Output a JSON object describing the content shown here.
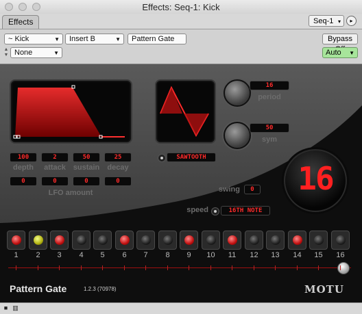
{
  "window": {
    "title": "Effects: Seq-1: Kick"
  },
  "tabs": {
    "effects": "Effects",
    "sequence": "Seq-1",
    "sequence_arrow": "▾",
    "play": "▸"
  },
  "controls": {
    "track": "~ Kick",
    "insert": "Insert B",
    "plugin_name": "Pattern Gate",
    "preset": "None",
    "bypass": "Bypass Off",
    "automation": "Auto"
  },
  "envelope": {
    "params": [
      {
        "label": "depth",
        "value": "100"
      },
      {
        "label": "attack",
        "value": "2"
      },
      {
        "label": "sustain",
        "value": "50"
      },
      {
        "label": "decay",
        "value": "25"
      }
    ],
    "lfo_label": "LFO amount",
    "lfo_values": [
      "0",
      "0",
      "0",
      "0"
    ]
  },
  "lfo": {
    "waveform": "SAWTOOTH",
    "period_label": "period",
    "period_value": "16",
    "sym_label": "sym",
    "sym_value": "50"
  },
  "swing": {
    "label": "swing",
    "value": "0"
  },
  "speed": {
    "label": "speed",
    "value": "16TH NOTE"
  },
  "display": {
    "value": "16"
  },
  "steps": [
    {
      "n": "1",
      "state": "on"
    },
    {
      "n": "2",
      "state": "accent"
    },
    {
      "n": "3",
      "state": "on"
    },
    {
      "n": "4",
      "state": "off"
    },
    {
      "n": "5",
      "state": "off"
    },
    {
      "n": "6",
      "state": "on"
    },
    {
      "n": "7",
      "state": "off"
    },
    {
      "n": "8",
      "state": "off"
    },
    {
      "n": "9",
      "state": "on"
    },
    {
      "n": "10",
      "state": "off"
    },
    {
      "n": "11",
      "state": "on"
    },
    {
      "n": "12",
      "state": "off"
    },
    {
      "n": "13",
      "state": "off"
    },
    {
      "n": "14",
      "state": "on"
    },
    {
      "n": "15",
      "state": "off"
    },
    {
      "n": "16",
      "state": "off"
    }
  ],
  "step_slider_value": 16,
  "footer": {
    "name": "Pattern Gate",
    "version": "1.2.3 (70978)",
    "brand": "MOTU"
  },
  "colors": {
    "accent_red": "#ff2020",
    "led_accent": "#e8f04a",
    "auto_green": "#a7e59b"
  }
}
